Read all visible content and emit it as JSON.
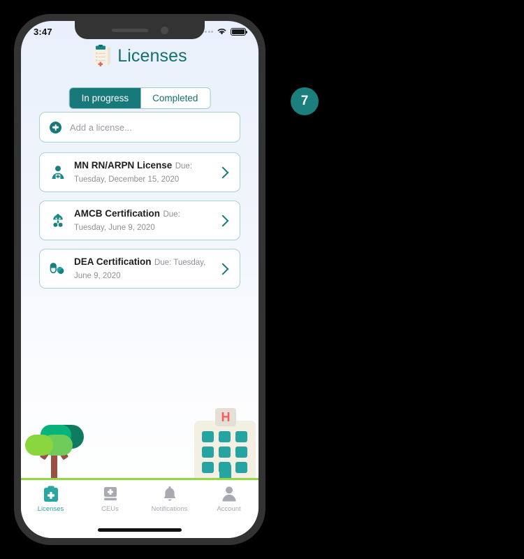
{
  "status_bar": {
    "time": "3:47",
    "signal_icon": "signal-dots-icon",
    "wifi_icon": "wifi-icon",
    "battery_icon": "battery-icon"
  },
  "header": {
    "title": "Licenses",
    "icon": "clipboard-icon"
  },
  "tabs": [
    {
      "label": "In progress",
      "active": true
    },
    {
      "label": "Completed",
      "active": false
    }
  ],
  "add_field": {
    "placeholder": "Add a license...",
    "value": "",
    "icon": "plus-circle-icon"
  },
  "licenses": [
    {
      "title": "MN RN/ARPN License",
      "due": "Due: Tuesday, December 15, 2020",
      "icon": "nurse-icon"
    },
    {
      "title": "AMCB Certification",
      "due": "Due: Tuesday, June 9, 2020",
      "icon": "baby-icon"
    },
    {
      "title": "DEA Certification",
      "due": "Due: Tuesday, June 9, 2020",
      "icon": "pills-icon"
    }
  ],
  "illustration": {
    "hospital_sign": "H",
    "tree_icon": "tree-icon",
    "hospital_icon": "hospital-icon"
  },
  "bottom_nav": [
    {
      "label": "Licenses",
      "icon": "clipboard-plus-icon",
      "active": true
    },
    {
      "label": "CEUs",
      "icon": "book-plus-icon",
      "active": false
    },
    {
      "label": "Notifications",
      "icon": "bell-icon",
      "active": false
    },
    {
      "label": "Account",
      "icon": "person-icon",
      "active": false
    }
  ],
  "step_badge": {
    "number": "7"
  },
  "colors": {
    "accent_teal": "#17797a",
    "title_teal": "#12706e",
    "nav_active": "#2aa5a2",
    "grass_green": "#92d840",
    "hospital_red": "#fb5b5b",
    "badge_teal": "#1a7f7d"
  }
}
